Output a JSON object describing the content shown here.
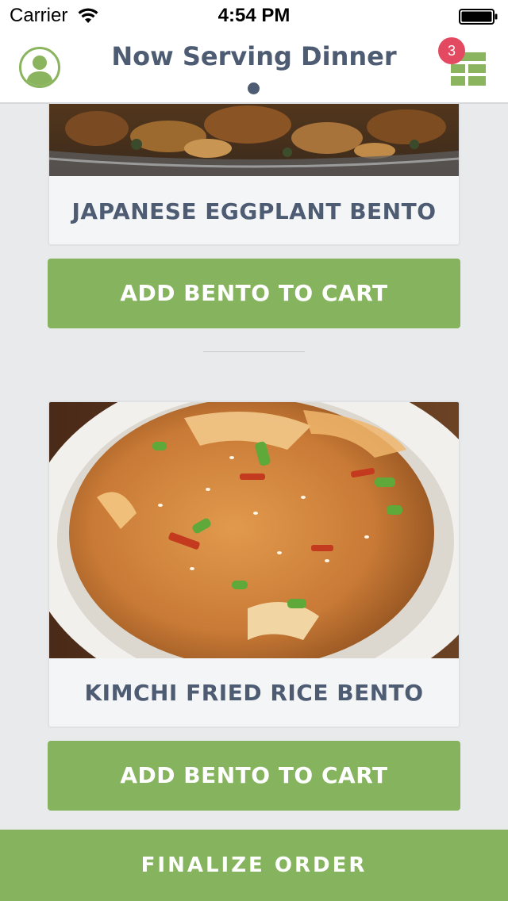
{
  "status_bar": {
    "carrier": "Carrier",
    "time": "4:54 PM"
  },
  "header": {
    "title": "Now Serving Dinner",
    "cart_count": "3",
    "icons": {
      "profile": "user-avatar-icon",
      "menu": "grid-menu-icon"
    }
  },
  "bentos": [
    {
      "name": "JAPANESE EGGPLANT BENTO",
      "button_label": "ADD BENTO TO CART"
    },
    {
      "name": "KIMCHI FRIED RICE BENTO",
      "button_label": "ADD BENTO TO CART"
    }
  ],
  "footer": {
    "finalize_label": "FINALIZE ORDER"
  },
  "colors": {
    "accent_green": "#86b35e",
    "title_slate": "#4e5c73",
    "badge_red": "#e34a62",
    "background": "#e8eaec"
  }
}
